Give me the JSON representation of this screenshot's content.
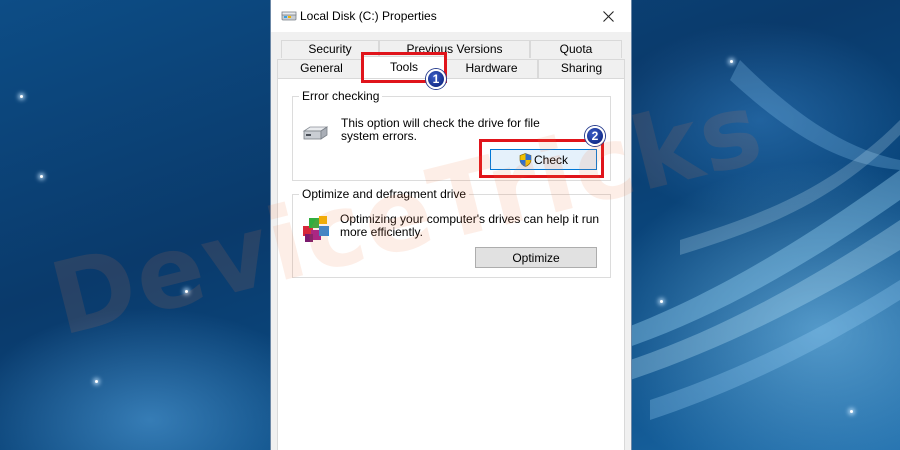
{
  "window": {
    "title": "Local Disk (C:) Properties",
    "close_symbol": "✕"
  },
  "tabs": {
    "row_top": [
      "Security",
      "Previous Versions",
      "Quota"
    ],
    "row_bottom": [
      "General",
      "Tools",
      "Hardware",
      "Sharing"
    ],
    "selected": "Tools"
  },
  "error_checking": {
    "label": "Error checking",
    "description_line1": "This option will check the drive for file",
    "description_line2": "system errors.",
    "check_button": "Check"
  },
  "optimize": {
    "label": "Optimize and defragment drive",
    "description_line1": "Optimizing your computer's drives can help it run",
    "description_line2": "more efficiently.",
    "optimize_button": "Optimize"
  },
  "annotations": {
    "step1": "1",
    "step2": "2",
    "highlight_color": "#e0141b",
    "badge_color": "#1a3a9e"
  },
  "watermark": "DeviceTricks",
  "icons": [
    "drive-icon",
    "uac-shield-icon",
    "defrag-icon",
    "close-icon"
  ]
}
